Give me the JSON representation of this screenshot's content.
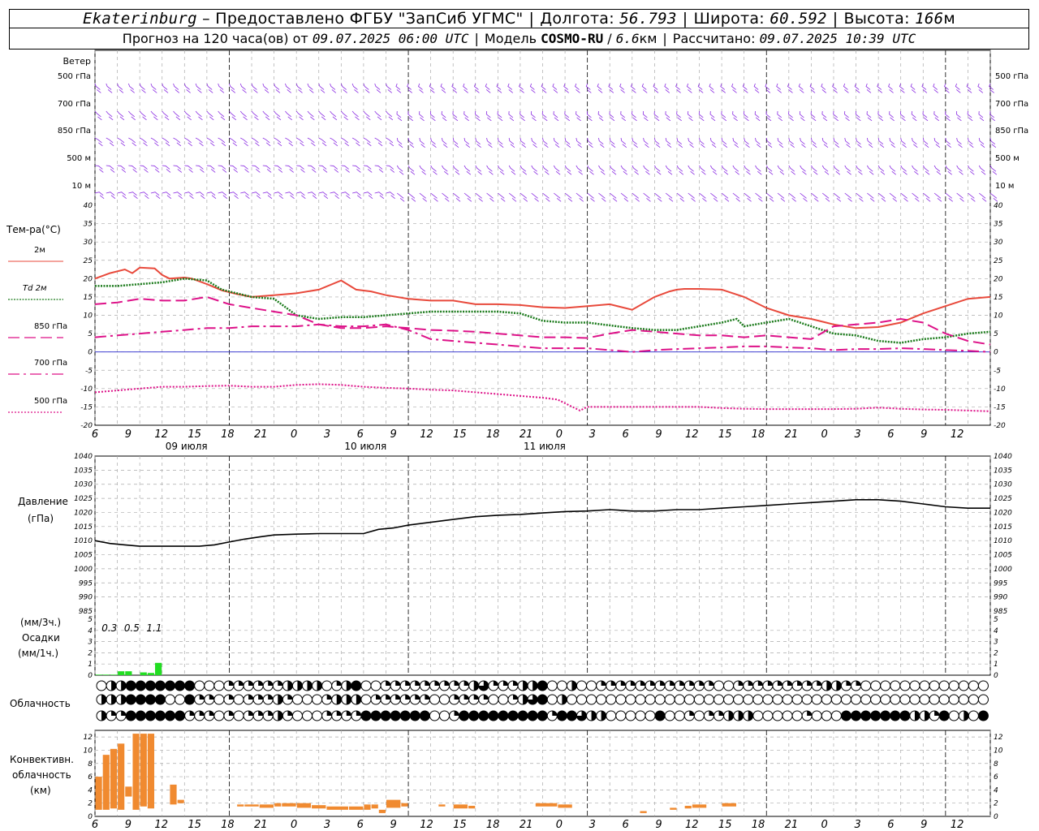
{
  "header": {
    "city": "Ekaterinburg",
    "provider": "– Предоставлено ФГБУ \"ЗапСиб УГМС\"",
    "lon_label": "Долгота:",
    "lon": "56.793",
    "lat_label": "Широта:",
    "lat": "60.592",
    "alt_label": "Высота:",
    "alt": "166",
    "alt_unit": "м",
    "forecast_label": "Прогноз на 120 часа(ов) от",
    "forecast_time": "09.07.2025 06:00 UTC",
    "model_label": "Модель",
    "model": "COSMO-RU",
    "model_res": "6.6",
    "model_res_unit": "км",
    "computed_label": "Рассчитано:",
    "computed_time": "09.07.2025 10:39 UTC"
  },
  "panel_labels": {
    "wind": "Ветер",
    "wind_levels": [
      "500 гПа",
      "700 гПа",
      "850 гПа",
      "500 м",
      "10 м"
    ],
    "temperature": "Тем-ра(°C)",
    "pressure_l1": "Давление",
    "pressure_l2": "(гПа)",
    "precip_l1": "(мм/3ч.)",
    "precip_l2": "Осадки",
    "precip_l3": "(мм/1ч.)",
    "cloud": "Облачность",
    "conv_l1": "Конвективн.",
    "conv_l2": "облачность",
    "conv_l3": "(км)"
  },
  "colors": {
    "t2m": "#e8493b",
    "td": "#1a7a1a",
    "t850": "#dd1188",
    "t700": "#dd1188",
    "t500": "#dd1188",
    "wind": "#8a2be2",
    "pressure": "#000000",
    "precip": "#22dd22",
    "conv": "#f08a30",
    "zero": "#2222cc"
  },
  "chart_data": [
    {
      "type": "line",
      "title": "Тем-ра(°C)",
      "ylim": [
        -20,
        40
      ],
      "yticks": [
        -20,
        -15,
        -10,
        -5,
        0,
        5,
        10,
        15,
        20,
        25,
        30,
        35,
        40
      ],
      "x_hours": [
        0,
        120
      ],
      "xtick_labels": [
        "6",
        "9",
        "12",
        "15",
        "18",
        "21",
        "0",
        "3",
        "6",
        "9",
        "12",
        "15",
        "18",
        "21",
        "0",
        "3",
        "6",
        "9",
        "12",
        "15",
        "18",
        "21",
        "0",
        "3",
        "6",
        "9",
        "12"
      ],
      "day_labels": [
        "09 июля",
        "10 июля",
        "11 июля"
      ],
      "series": [
        {
          "name": "2м",
          "x": [
            0,
            2,
            4,
            5,
            6,
            8,
            9,
            10,
            12,
            13,
            15,
            17,
            19,
            21,
            24,
            27,
            30,
            33,
            35,
            37,
            39,
            42,
            45,
            48,
            51,
            54,
            57,
            60,
            63,
            66,
            69,
            72,
            75,
            77,
            78,
            79,
            80,
            81,
            84,
            87,
            90,
            93,
            96,
            99,
            102,
            105,
            108,
            111,
            114,
            117,
            120
          ],
          "y": [
            20,
            21.5,
            22.5,
            21.5,
            23,
            22.8,
            21,
            20,
            20.3,
            20,
            18.5,
            16.8,
            15.8,
            15,
            15.5,
            16,
            17,
            19.5,
            17,
            16.5,
            15.5,
            14.5,
            14,
            14,
            13,
            13,
            12.8,
            12.2,
            12,
            12.5,
            13,
            11.5,
            15,
            16.5,
            17,
            17.2,
            17.2,
            17.2,
            17,
            15,
            12,
            10,
            9,
            7.5,
            6.5,
            6.8,
            8,
            10.5,
            12.5,
            14.5,
            15
          ]
        },
        {
          "name": "Td 2м",
          "x": [
            0,
            3,
            6,
            9,
            12,
            15,
            17,
            21,
            24,
            27,
            30,
            33,
            36,
            39,
            42,
            45,
            48,
            51,
            54,
            57,
            60,
            63,
            66,
            68,
            72,
            75,
            78,
            81,
            84,
            86,
            87,
            90,
            93,
            96,
            99,
            102,
            105,
            108,
            111,
            114,
            117,
            120
          ],
          "y": [
            18,
            18,
            18.5,
            19,
            20,
            19.5,
            17,
            15,
            14.5,
            10,
            9,
            9.5,
            9.5,
            10,
            10.5,
            11,
            11,
            11,
            11,
            10.5,
            8.5,
            8,
            8,
            7.5,
            6.5,
            6,
            6,
            7,
            8,
            9,
            7,
            8,
            9,
            7,
            5,
            4.5,
            3,
            2.5,
            3.5,
            4,
            5,
            5.5
          ]
        },
        {
          "name": "850 гПа",
          "x": [
            0,
            3,
            6,
            9,
            12,
            15,
            18,
            21,
            24,
            27,
            30,
            33,
            36,
            39,
            42,
            45,
            48,
            51,
            54,
            57,
            60,
            63,
            66,
            69,
            72,
            75,
            78,
            81,
            84,
            87,
            90,
            93,
            96,
            99,
            102,
            105,
            108,
            111,
            114,
            117,
            120
          ],
          "y": [
            13,
            13.5,
            14.5,
            14,
            14,
            15,
            13,
            12,
            11,
            10,
            7.5,
            6.5,
            6.5,
            7,
            6.5,
            6,
            5.8,
            5.5,
            5,
            4.5,
            4,
            4,
            3.8,
            5,
            6,
            5.5,
            5,
            4.5,
            4.5,
            4,
            4.5,
            4,
            3.5,
            7,
            7.5,
            8,
            9,
            8,
            5,
            3,
            2
          ]
        },
        {
          "name": "700 гПа",
          "x": [
            0,
            3,
            6,
            9,
            12,
            15,
            18,
            21,
            24,
            27,
            30,
            33,
            36,
            39,
            42,
            45,
            48,
            51,
            54,
            57,
            60,
            63,
            66,
            69,
            72,
            75,
            78,
            81,
            84,
            87,
            90,
            93,
            96,
            99,
            102,
            105,
            108,
            111,
            114,
            117,
            120
          ],
          "y": [
            4,
            4.5,
            5,
            5.5,
            6,
            6.5,
            6.5,
            7,
            7,
            7,
            7.5,
            7,
            7,
            7.5,
            6,
            3.5,
            3,
            2.5,
            2,
            1.5,
            1,
            1,
            1,
            0.5,
            0,
            0.5,
            0.8,
            1,
            1.2,
            1.5,
            1.5,
            1.2,
            1,
            0.5,
            0.8,
            0.8,
            1,
            0.8,
            0.5,
            0.3,
            0
          ]
        },
        {
          "name": "500 гПа",
          "x": [
            0,
            3,
            6,
            9,
            12,
            15,
            18,
            21,
            24,
            27,
            30,
            33,
            36,
            39,
            42,
            45,
            48,
            51,
            54,
            57,
            60,
            62,
            63,
            64,
            65,
            66,
            69,
            72,
            75,
            78,
            81,
            84,
            87,
            90,
            93,
            96,
            99,
            102,
            105,
            108,
            111,
            114,
            117,
            120
          ],
          "y": [
            -11,
            -10.5,
            -10,
            -9.5,
            -9.5,
            -9.3,
            -9.2,
            -9.5,
            -9.5,
            -9,
            -8.8,
            -9,
            -9.5,
            -9.8,
            -10,
            -10.3,
            -10.5,
            -11,
            -11.5,
            -12,
            -12.5,
            -13,
            -14,
            -15,
            -16,
            -15,
            -15,
            -15,
            -15,
            -15,
            -15,
            -15.3,
            -15.5,
            -15.6,
            -15.6,
            -15.6,
            -15.6,
            -15.5,
            -15.2,
            -15.5,
            -15.7,
            -15.8,
            -16,
            -16.2
          ]
        }
      ]
    },
    {
      "type": "line",
      "title": "Давление",
      "ylabel": "(гПа)",
      "ylim": [
        985,
        1040
      ],
      "yticks": [
        985,
        990,
        995,
        1000,
        1005,
        1010,
        1015,
        1020,
        1025,
        1030,
        1035,
        1040
      ],
      "series": [
        {
          "x": [
            0,
            2,
            4,
            6,
            8,
            10,
            12,
            14,
            16,
            18,
            20,
            22,
            24,
            27,
            30,
            33,
            36,
            38,
            40,
            42,
            45,
            48,
            51,
            54,
            57,
            60,
            63,
            66,
            69,
            72,
            75,
            78,
            81,
            84,
            87,
            90,
            93,
            96,
            99,
            102,
            105,
            108,
            111,
            114,
            117,
            120
          ],
          "y": [
            1010,
            1009,
            1008.5,
            1008,
            1008,
            1008,
            1008,
            1008,
            1008.5,
            1009.5,
            1010.5,
            1011.3,
            1012,
            1012.3,
            1012.5,
            1012.5,
            1012.5,
            1014,
            1014.5,
            1015.5,
            1016.5,
            1017.5,
            1018.5,
            1019,
            1019.3,
            1019.8,
            1020.3,
            1020.5,
            1021,
            1020.5,
            1020.5,
            1021,
            1021,
            1021.5,
            1022,
            1022.5,
            1023,
            1023.5,
            1024,
            1024.5,
            1024.5,
            1024,
            1023,
            1022,
            1021.5,
            1021.5
          ]
        }
      ]
    },
    {
      "type": "bar",
      "title": "Осадки",
      "ylim": [
        0,
        5
      ],
      "yticks": [
        0,
        1,
        2,
        3,
        4,
        5
      ],
      "sums_3h": [
        {
          "x": 1.5,
          "label": "0.3"
        },
        {
          "x": 4.5,
          "label": "0.5"
        },
        {
          "x": 7.5,
          "label": "1.1"
        }
      ],
      "bars": [
        {
          "x": 0,
          "value": 0.05
        },
        {
          "x": 1,
          "value": 0.05
        },
        {
          "x": 2,
          "value": 0.05
        },
        {
          "x": 3,
          "value": 0.35
        },
        {
          "x": 4,
          "value": 0.35
        },
        {
          "x": 6,
          "value": 0.25
        },
        {
          "x": 7,
          "value": 0.2
        },
        {
          "x": 8,
          "value": 1.1
        }
      ]
    },
    {
      "type": "heatmap",
      "title": "Облачность",
      "rows": [
        "0224444444000111111222201240011111111123111224002001111111111110011111111122110000000000000",
        "2224444004110101112100012220111111001111001234020000000000000000000000000000000000000000000",
        "2114444441110101112100011114444444001444444444144322000004001011222000001000444444422140204"
      ]
    },
    {
      "type": "bar",
      "title": "Конвективн. облачность (км)",
      "ylim": [
        0,
        13
      ],
      "yticks": [
        0,
        2,
        4,
        6,
        8,
        10,
        12
      ],
      "bars": [
        {
          "x0": 0,
          "x1": 1,
          "base": 1,
          "top": 6
        },
        {
          "x0": 1,
          "x1": 2,
          "base": 1,
          "top": 9.3
        },
        {
          "x0": 2,
          "x1": 3,
          "base": 1.2,
          "top": 10.2
        },
        {
          "x0": 3,
          "x1": 4,
          "base": 1,
          "top": 11
        },
        {
          "x0": 4,
          "x1": 5,
          "base": 3,
          "top": 4.5
        },
        {
          "x0": 5,
          "x1": 6,
          "base": 1,
          "top": 12.5
        },
        {
          "x0": 6,
          "x1": 7,
          "base": 1.5,
          "top": 12.5
        },
        {
          "x0": 7,
          "x1": 8,
          "base": 1.2,
          "top": 12.5
        },
        {
          "x0": 10,
          "x1": 11,
          "base": 1.8,
          "top": 4.8
        },
        {
          "x0": 11,
          "x1": 12,
          "base": 2,
          "top": 2.5
        },
        {
          "x0": 19,
          "x1": 20,
          "base": 1.5,
          "top": 1.8
        },
        {
          "x0": 20,
          "x1": 22,
          "base": 1.5,
          "top": 1.8
        },
        {
          "x0": 22,
          "x1": 24,
          "base": 1.3,
          "top": 1.8
        },
        {
          "x0": 24,
          "x1": 25,
          "base": 1.5,
          "top": 2
        },
        {
          "x0": 25,
          "x1": 27,
          "base": 1.5,
          "top": 2
        },
        {
          "x0": 27,
          "x1": 29,
          "base": 1.3,
          "top": 2
        },
        {
          "x0": 29,
          "x1": 31,
          "base": 1.2,
          "top": 1.7
        },
        {
          "x0": 31,
          "x1": 34,
          "base": 1,
          "top": 1.5
        },
        {
          "x0": 34,
          "x1": 36,
          "base": 1,
          "top": 1.5
        },
        {
          "x0": 36,
          "x1": 37,
          "base": 1,
          "top": 1.8
        },
        {
          "x0": 37,
          "x1": 38,
          "base": 1.2,
          "top": 1.8
        },
        {
          "x0": 38,
          "x1": 39,
          "base": 0.5,
          "top": 1
        },
        {
          "x0": 39,
          "x1": 41,
          "base": 1.3,
          "top": 2.5
        },
        {
          "x0": 41,
          "x1": 42,
          "base": 1.5,
          "top": 2
        },
        {
          "x0": 46,
          "x1": 47,
          "base": 1.5,
          "top": 1.8
        },
        {
          "x0": 48,
          "x1": 50,
          "base": 1.2,
          "top": 1.8
        },
        {
          "x0": 50,
          "x1": 51,
          "base": 1.2,
          "top": 1.6
        },
        {
          "x0": 59,
          "x1": 62,
          "base": 1.5,
          "top": 2
        },
        {
          "x0": 62,
          "x1": 64,
          "base": 1.3,
          "top": 1.8
        },
        {
          "x0": 73,
          "x1": 74,
          "base": 0.5,
          "top": 0.8
        },
        {
          "x0": 77,
          "x1": 78,
          "base": 1,
          "top": 1.3
        },
        {
          "x0": 79,
          "x1": 80,
          "base": 1.2,
          "top": 1.6
        },
        {
          "x0": 80,
          "x1": 82,
          "base": 1.3,
          "top": 1.8
        },
        {
          "x0": 84,
          "x1": 86,
          "base": 1.5,
          "top": 2
        }
      ]
    }
  ]
}
